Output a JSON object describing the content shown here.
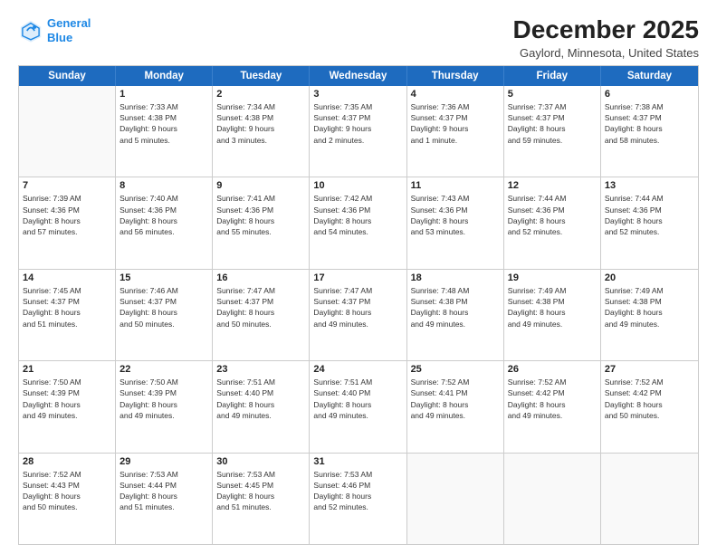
{
  "header": {
    "logo_line1": "General",
    "logo_line2": "Blue",
    "month": "December 2025",
    "location": "Gaylord, Minnesota, United States"
  },
  "days_of_week": [
    "Sunday",
    "Monday",
    "Tuesday",
    "Wednesday",
    "Thursday",
    "Friday",
    "Saturday"
  ],
  "rows": [
    [
      {
        "day": "",
        "info": ""
      },
      {
        "day": "1",
        "info": "Sunrise: 7:33 AM\nSunset: 4:38 PM\nDaylight: 9 hours\nand 5 minutes."
      },
      {
        "day": "2",
        "info": "Sunrise: 7:34 AM\nSunset: 4:38 PM\nDaylight: 9 hours\nand 3 minutes."
      },
      {
        "day": "3",
        "info": "Sunrise: 7:35 AM\nSunset: 4:37 PM\nDaylight: 9 hours\nand 2 minutes."
      },
      {
        "day": "4",
        "info": "Sunrise: 7:36 AM\nSunset: 4:37 PM\nDaylight: 9 hours\nand 1 minute."
      },
      {
        "day": "5",
        "info": "Sunrise: 7:37 AM\nSunset: 4:37 PM\nDaylight: 8 hours\nand 59 minutes."
      },
      {
        "day": "6",
        "info": "Sunrise: 7:38 AM\nSunset: 4:37 PM\nDaylight: 8 hours\nand 58 minutes."
      }
    ],
    [
      {
        "day": "7",
        "info": "Sunrise: 7:39 AM\nSunset: 4:36 PM\nDaylight: 8 hours\nand 57 minutes."
      },
      {
        "day": "8",
        "info": "Sunrise: 7:40 AM\nSunset: 4:36 PM\nDaylight: 8 hours\nand 56 minutes."
      },
      {
        "day": "9",
        "info": "Sunrise: 7:41 AM\nSunset: 4:36 PM\nDaylight: 8 hours\nand 55 minutes."
      },
      {
        "day": "10",
        "info": "Sunrise: 7:42 AM\nSunset: 4:36 PM\nDaylight: 8 hours\nand 54 minutes."
      },
      {
        "day": "11",
        "info": "Sunrise: 7:43 AM\nSunset: 4:36 PM\nDaylight: 8 hours\nand 53 minutes."
      },
      {
        "day": "12",
        "info": "Sunrise: 7:44 AM\nSunset: 4:36 PM\nDaylight: 8 hours\nand 52 minutes."
      },
      {
        "day": "13",
        "info": "Sunrise: 7:44 AM\nSunset: 4:36 PM\nDaylight: 8 hours\nand 52 minutes."
      }
    ],
    [
      {
        "day": "14",
        "info": "Sunrise: 7:45 AM\nSunset: 4:37 PM\nDaylight: 8 hours\nand 51 minutes."
      },
      {
        "day": "15",
        "info": "Sunrise: 7:46 AM\nSunset: 4:37 PM\nDaylight: 8 hours\nand 50 minutes."
      },
      {
        "day": "16",
        "info": "Sunrise: 7:47 AM\nSunset: 4:37 PM\nDaylight: 8 hours\nand 50 minutes."
      },
      {
        "day": "17",
        "info": "Sunrise: 7:47 AM\nSunset: 4:37 PM\nDaylight: 8 hours\nand 49 minutes."
      },
      {
        "day": "18",
        "info": "Sunrise: 7:48 AM\nSunset: 4:38 PM\nDaylight: 8 hours\nand 49 minutes."
      },
      {
        "day": "19",
        "info": "Sunrise: 7:49 AM\nSunset: 4:38 PM\nDaylight: 8 hours\nand 49 minutes."
      },
      {
        "day": "20",
        "info": "Sunrise: 7:49 AM\nSunset: 4:38 PM\nDaylight: 8 hours\nand 49 minutes."
      }
    ],
    [
      {
        "day": "21",
        "info": "Sunrise: 7:50 AM\nSunset: 4:39 PM\nDaylight: 8 hours\nand 49 minutes."
      },
      {
        "day": "22",
        "info": "Sunrise: 7:50 AM\nSunset: 4:39 PM\nDaylight: 8 hours\nand 49 minutes."
      },
      {
        "day": "23",
        "info": "Sunrise: 7:51 AM\nSunset: 4:40 PM\nDaylight: 8 hours\nand 49 minutes."
      },
      {
        "day": "24",
        "info": "Sunrise: 7:51 AM\nSunset: 4:40 PM\nDaylight: 8 hours\nand 49 minutes."
      },
      {
        "day": "25",
        "info": "Sunrise: 7:52 AM\nSunset: 4:41 PM\nDaylight: 8 hours\nand 49 minutes."
      },
      {
        "day": "26",
        "info": "Sunrise: 7:52 AM\nSunset: 4:42 PM\nDaylight: 8 hours\nand 49 minutes."
      },
      {
        "day": "27",
        "info": "Sunrise: 7:52 AM\nSunset: 4:42 PM\nDaylight: 8 hours\nand 50 minutes."
      }
    ],
    [
      {
        "day": "28",
        "info": "Sunrise: 7:52 AM\nSunset: 4:43 PM\nDaylight: 8 hours\nand 50 minutes."
      },
      {
        "day": "29",
        "info": "Sunrise: 7:53 AM\nSunset: 4:44 PM\nDaylight: 8 hours\nand 51 minutes."
      },
      {
        "day": "30",
        "info": "Sunrise: 7:53 AM\nSunset: 4:45 PM\nDaylight: 8 hours\nand 51 minutes."
      },
      {
        "day": "31",
        "info": "Sunrise: 7:53 AM\nSunset: 4:46 PM\nDaylight: 8 hours\nand 52 minutes."
      },
      {
        "day": "",
        "info": ""
      },
      {
        "day": "",
        "info": ""
      },
      {
        "day": "",
        "info": ""
      }
    ]
  ]
}
